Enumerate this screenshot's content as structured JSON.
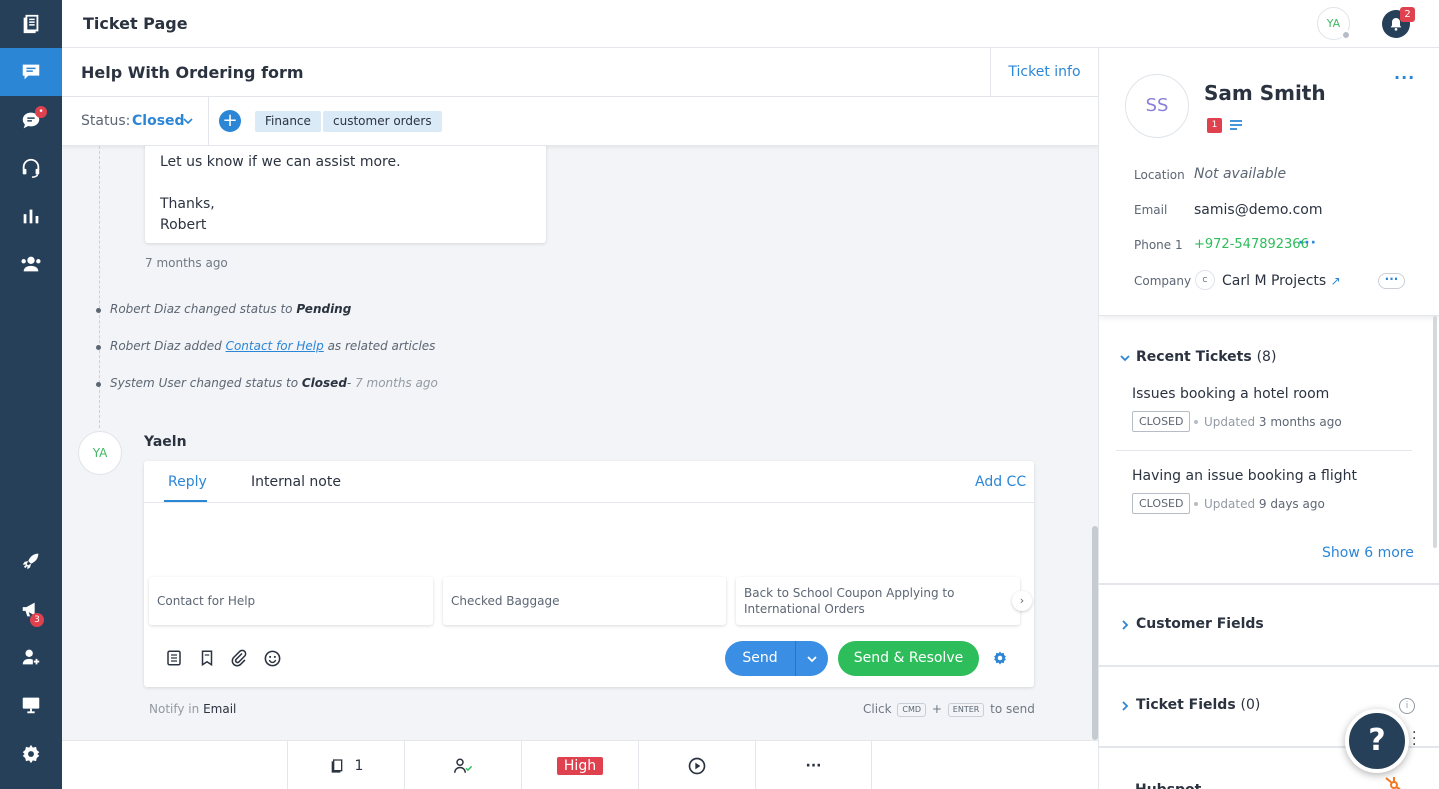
{
  "topbar": {
    "title": "Ticket Page",
    "user_initials": "YA",
    "notifications_count": "2"
  },
  "nav": {
    "items": [
      {
        "name": "knowledge-base",
        "icon": "book-icon"
      },
      {
        "name": "tickets",
        "icon": "chat-icon",
        "active": true
      },
      {
        "name": "live-chat",
        "icon": "chat-bubble-icon",
        "badge": "•"
      },
      {
        "name": "calls",
        "icon": "headset-icon"
      },
      {
        "name": "reports",
        "icon": "bar-chart-icon"
      },
      {
        "name": "customers",
        "icon": "users-icon"
      },
      {
        "name": "getting-started",
        "icon": "rocket-icon"
      },
      {
        "name": "announcements",
        "icon": "megaphone-icon",
        "badge": "3"
      },
      {
        "name": "add-agent",
        "icon": "user-plus-icon"
      },
      {
        "name": "widget",
        "icon": "monitor-icon"
      },
      {
        "name": "settings",
        "icon": "gear-icon"
      }
    ]
  },
  "ticket": {
    "title": "Help With Ordering form",
    "ticket_info_label": "Ticket info",
    "status_label": "Status:",
    "status_value": "Closed",
    "tags": [
      "Finance",
      "customer orders"
    ]
  },
  "timeline": {
    "message_lines": [
      "Let us know if we can assist more.",
      "",
      "Thanks,",
      "Robert"
    ],
    "message_time": "7 months ago",
    "events": [
      {
        "pre": "Robert Diaz changed status to ",
        "bold": "Pending",
        "post": ""
      },
      {
        "pre": "Robert Diaz added ",
        "link": "Contact for Help",
        "post": " as related articles"
      },
      {
        "pre": "System User changed status to ",
        "bold": "Closed",
        "post": "- ",
        "time": "7 months ago"
      }
    ]
  },
  "reply": {
    "avatar_initials": "YA",
    "author": "Yaeln",
    "tab_reply": "Reply",
    "tab_note": "Internal note",
    "add_cc": "Add CC",
    "suggestions": [
      "Contact for Help",
      "Checked Baggage",
      "Back to School Coupon Applying to International Orders"
    ],
    "send_label": "Send",
    "send_resolve_label": "Send & Resolve",
    "notify_prefix": "Notify in",
    "notify_channel": "Email",
    "hint_click": "Click",
    "hint_key1": "CMD",
    "hint_plus": "+",
    "hint_key2": "ENTER",
    "hint_suffix": "to send"
  },
  "bottombar": {
    "kb_count": "1",
    "priority": "High",
    "more": "···"
  },
  "contact": {
    "initials": "SS",
    "name": "Sam Smith",
    "badge": "1",
    "location_label": "Location",
    "location_value": "Not available",
    "email_label": "Email",
    "email_value": "samis@demo.com",
    "phone_label": "Phone 1",
    "phone_value": "+972-547892366",
    "company_label": "Company",
    "company_initial": "C",
    "company_value": "Carl M Projects",
    "company_arrow": "↗"
  },
  "recent_tickets": {
    "title": "Recent Tickets",
    "count": "(8)",
    "items": [
      {
        "title": "Issues booking a hotel room",
        "status": "CLOSED",
        "updated_prefix": "Updated",
        "updated": "3 months ago"
      },
      {
        "title": "Having an issue booking a flight",
        "status": "CLOSED",
        "updated_prefix": "Updated",
        "updated": "9 days ago"
      }
    ],
    "show_more": "Show 6 more"
  },
  "sections": {
    "customer_fields": "Customer Fields",
    "ticket_fields": "Ticket Fields",
    "ticket_fields_count": "(0)",
    "hubspot": "Hubspot"
  },
  "help": {
    "label": "?"
  },
  "colors": {
    "nav_bg": "#26405a",
    "accent": "#2c86d6",
    "success": "#2dbd5a",
    "danger": "#e0414e"
  }
}
